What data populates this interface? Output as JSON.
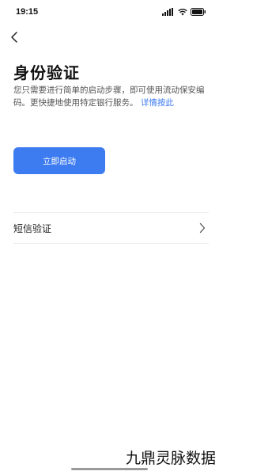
{
  "status_bar": {
    "time": "19:15",
    "icons": [
      "signal-icon",
      "wifi-icon",
      "battery-icon"
    ]
  },
  "header": {
    "back_icon": "chevron-left-icon"
  },
  "main": {
    "title": "身份验证",
    "description": "您只需要进行简单的启动步骤，即可使用流动保安编码。更快捷地使用特定银行服务。",
    "detail_link": "详情按此",
    "start_button_label": "立即启动",
    "options": [
      {
        "label": "短信验证",
        "icon": "chevron-right-icon"
      }
    ]
  },
  "watermark": "九鼎灵脉数据",
  "colors": {
    "accent": "#3d7bf0",
    "background": "#ffffff",
    "title": "#111111",
    "body_text": "#555555",
    "divider": "#ececec"
  }
}
